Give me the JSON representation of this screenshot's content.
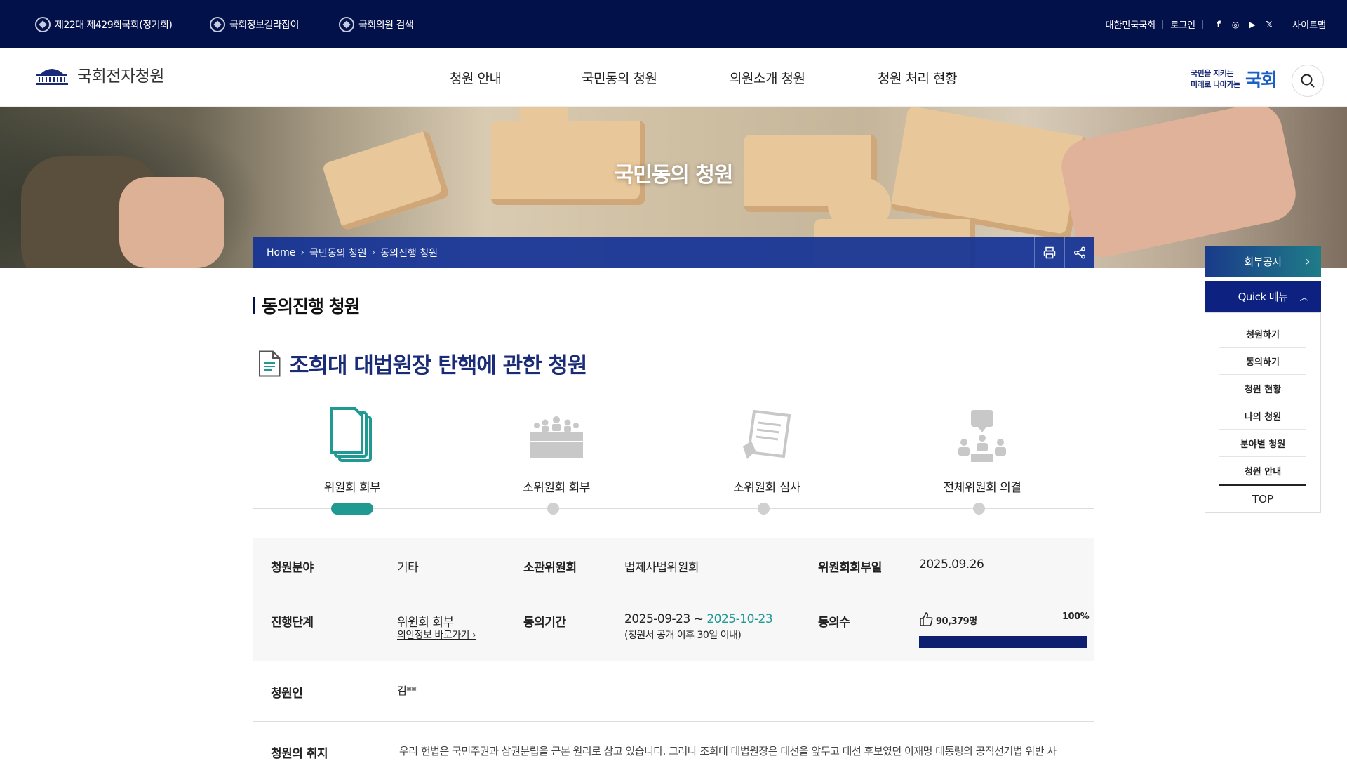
{
  "topbar": {
    "links": [
      "제22대 제429회국회(정기회)",
      "국회정보길라잡이",
      "국회의원 검색"
    ],
    "right": [
      "대한민국국회",
      "로그인",
      "사이트맵"
    ],
    "sns": [
      "f",
      "◎",
      "▶",
      "𝕏"
    ]
  },
  "header": {
    "logo": "국회전자청원",
    "menu": [
      "청원 안내",
      "국민동의 청원",
      "의원소개 청원",
      "청원 처리 현황"
    ],
    "slogan_line1": "국민을 지키는",
    "slogan_line2": "미래로 나아가는",
    "slogan_mark": "국회"
  },
  "banner": {
    "title": "국민동의 청원"
  },
  "breadcrumb": [
    "Home",
    "국민동의 청원",
    "동의진행 청원"
  ],
  "page": {
    "section_title": "동의진행 청원",
    "petition_title": "조희대 대법원장 탄핵에 관한 청원"
  },
  "steps": [
    {
      "label": "위원회 회부",
      "active": true
    },
    {
      "label": "소위원회 회부",
      "active": false
    },
    {
      "label": "소위원회 심사",
      "active": false
    },
    {
      "label": "전체위원회 의결",
      "active": false
    }
  ],
  "info": {
    "field_label": "청원분야",
    "field": "기타",
    "committee_label": "소관위원회",
    "committee": "법제사법위원회",
    "referral_date_label": "위원회회부일",
    "referral_date": "2025.09.26",
    "stage_label": "진행단계",
    "stage": "위원회 회부",
    "stage_link": "의안정보 바로가기",
    "period_label": "동의기간",
    "period_start": "2025-09-23",
    "period_sep": " ~ ",
    "period_end": "2025-10-23",
    "period_note": "(청원서 공개 이후 30일 이내)",
    "agree_label": "동의수",
    "agree_count": "90,379명",
    "agree_percent": "100%",
    "agree_ratio": 1.0,
    "petitioner_label": "청원인",
    "petitioner": "김**",
    "purpose_label": "청원의 취지",
    "purpose": "우리 헌법은 국민주권과 삼권분립을 근본 원리로 삼고 있습니다. 그러나 조희대 대법원장은 대선을 앞두고 대선 후보였던 이재명 대통령의 공직선거법 위반 사"
  },
  "quick": {
    "notice": "회부공지",
    "menu_title": "Quick 메뉴",
    "items": [
      "청원하기",
      "동의하기",
      "청원 현황",
      "나의 청원",
      "분야별 청원",
      "청원 안내"
    ],
    "top": "TOP"
  },
  "colors": {
    "navy": "#03114a",
    "teal": "#1f9992",
    "blue": "#1a2b78"
  }
}
